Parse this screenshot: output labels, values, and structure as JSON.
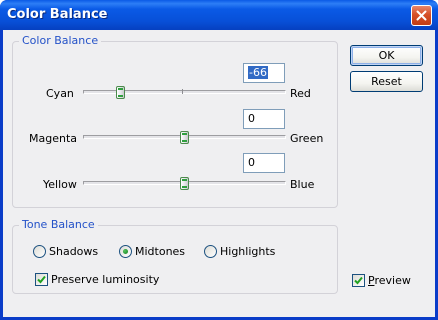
{
  "window": {
    "title": "Color Balance"
  },
  "color_balance": {
    "group_label": "Color Balance",
    "sliders": [
      {
        "left_label": "Cyan",
        "right_label": "Red",
        "value": "-66",
        "level": -66,
        "range": [
          -100,
          100
        ]
      },
      {
        "left_label": "Magenta",
        "right_label": "Green",
        "value": "0",
        "level": 0,
        "range": [
          -100,
          100
        ]
      },
      {
        "left_label": "Yellow",
        "right_label": "Blue",
        "value": "0",
        "level": 0,
        "range": [
          -100,
          100
        ]
      }
    ]
  },
  "tone_balance": {
    "group_label": "Tone Balance",
    "options": [
      {
        "label": "Shadows",
        "checked": false
      },
      {
        "label": "Midtones",
        "checked": true
      },
      {
        "label": "Highlights",
        "checked": false
      }
    ],
    "preserve_luminosity": {
      "label": "Preserve luminosity",
      "checked": true
    }
  },
  "buttons": {
    "ok": "OK",
    "reset": "Reset"
  },
  "preview": {
    "label": "Preview",
    "checked": true
  },
  "colors": {
    "titlebar": "#0a5ae6",
    "dialog_bg": "#efeff1",
    "group_label": "#2452c8",
    "close_button": "#d65028",
    "thumb_accent": "#2fa03f"
  },
  "icons": {
    "close": "close-icon",
    "check": "checkmark-icon"
  }
}
